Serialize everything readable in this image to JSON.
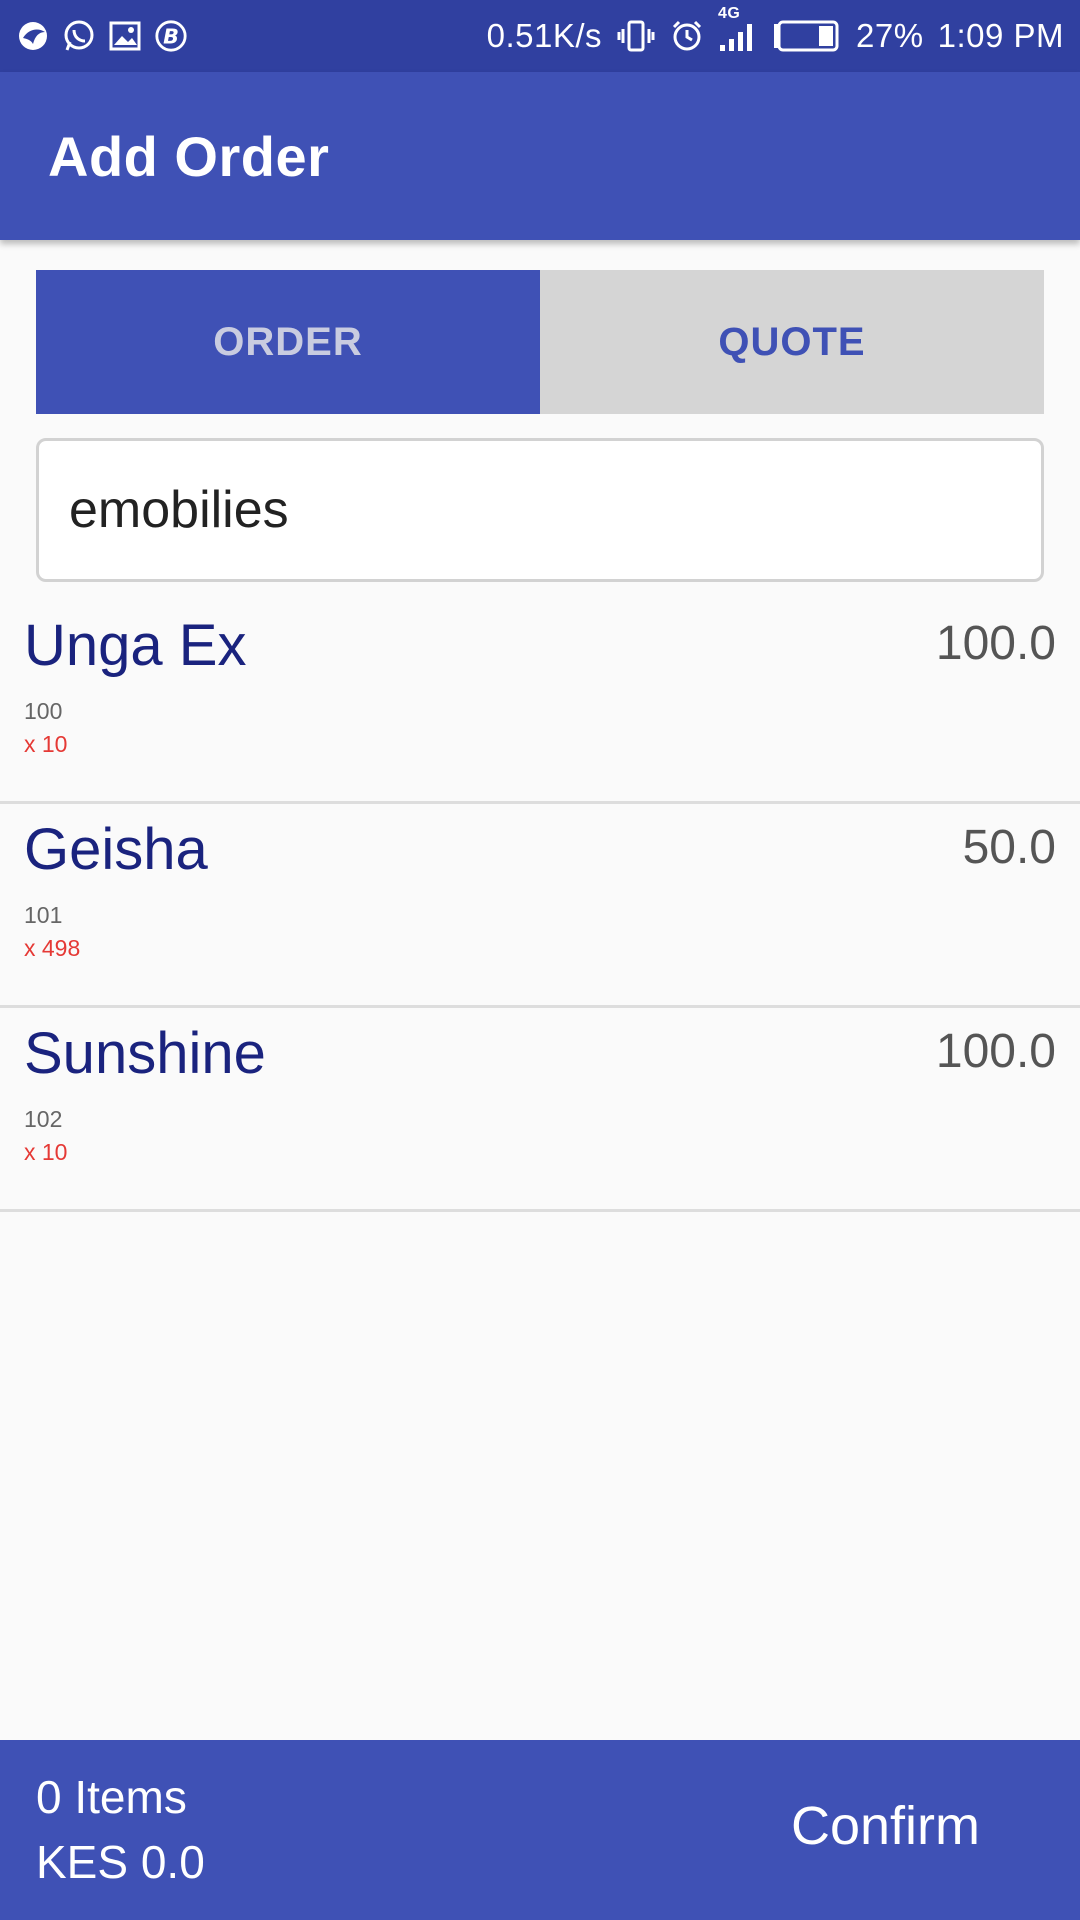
{
  "status_bar": {
    "net_speed": "0.51K/s",
    "network_type": "4G",
    "battery": "27%",
    "time": "1:09 PM",
    "icons_left": [
      "bird-app-icon",
      "whatsapp-icon",
      "gallery-icon",
      "b-circle-icon"
    ],
    "icons_right": [
      "vibrate-icon",
      "alarm-icon",
      "signal-icon",
      "battery-icon"
    ]
  },
  "app_bar": {
    "title": "Add Order"
  },
  "tabs": {
    "order_label": "ORDER",
    "quote_label": "QUOTE",
    "selected": "ORDER"
  },
  "search": {
    "value": "emobilies",
    "placeholder": ""
  },
  "products": [
    {
      "name": "Unga Ex",
      "code": "100",
      "qty": "x 10",
      "price": "100.0"
    },
    {
      "name": "Geisha",
      "code": "101",
      "qty": "x 498",
      "price": "50.0"
    },
    {
      "name": "Sunshine",
      "code": "102",
      "qty": "x 10",
      "price": "100.0"
    }
  ],
  "bottom_bar": {
    "items_count": "0 Items",
    "total": "KES 0.0",
    "confirm_label": "Confirm"
  },
  "colors": {
    "primary": "#3f51b5",
    "primary_dark": "#3040a0",
    "product_name": "#1a237e",
    "qty_text": "#e53935",
    "tab_inactive_bg": "#d5d5d5"
  }
}
